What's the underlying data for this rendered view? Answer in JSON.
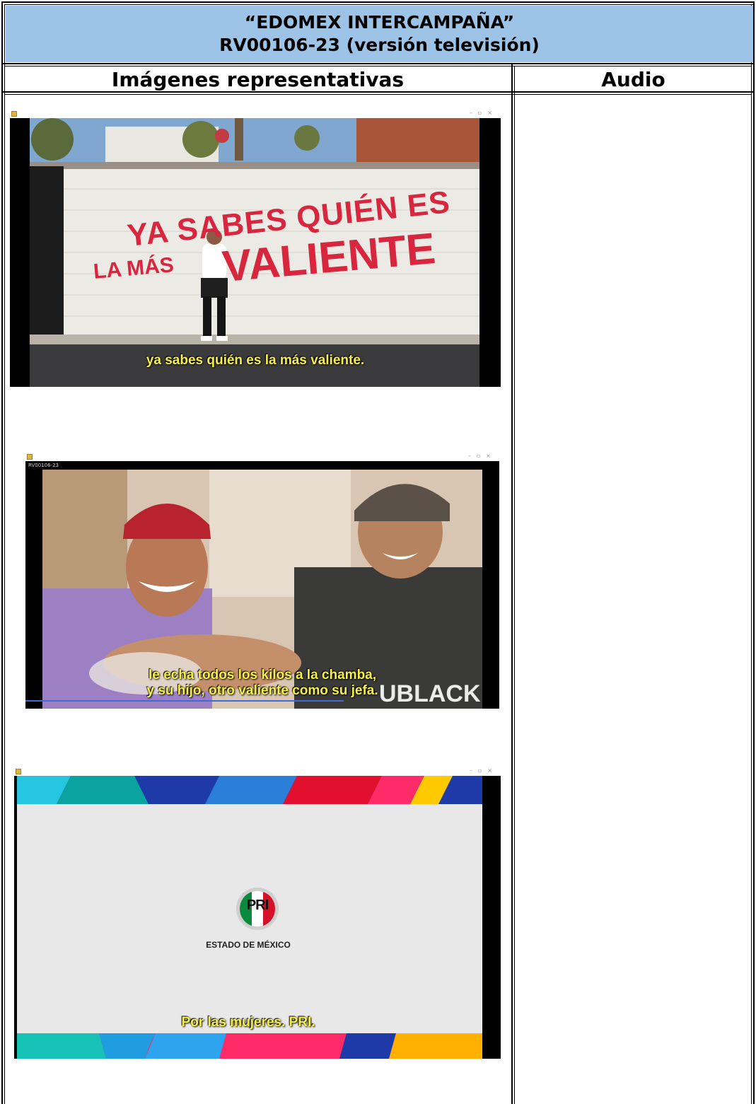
{
  "title": {
    "line1": "“EDOMEX INTERCAMPAÑA”",
    "line2": "RV00106-23 (versión televisión)"
  },
  "columns": {
    "images": "Imágenes representativas",
    "audio": "Audio"
  },
  "shots": [
    {
      "wall_text_line1": "YA SABES QUIÉN ES",
      "wall_text_line2_a": "LA MÁS",
      "wall_text_line2_b": "VALIENTE",
      "subtitle": "ya sabes quién es la más valiente."
    },
    {
      "window_title": "RV00106-23",
      "shirt_text": "UBLACK",
      "subtitle_line1": "le echa todos los kilos a la chamba,",
      "subtitle_line2": "y su hijo, otro valiente como su jefa."
    },
    {
      "logo_text": "PRI",
      "logo_caption": "ESTADO DE MÉXICO",
      "subtitle": "Por las mujeres. PRI."
    }
  ],
  "colors": {
    "title_bg": "#9dc3e6",
    "subtitle_yellow": "#f7f04a",
    "wall_red": "#d7263d",
    "pri_green": "#0a8a3c",
    "pri_red": "#d3122a"
  }
}
